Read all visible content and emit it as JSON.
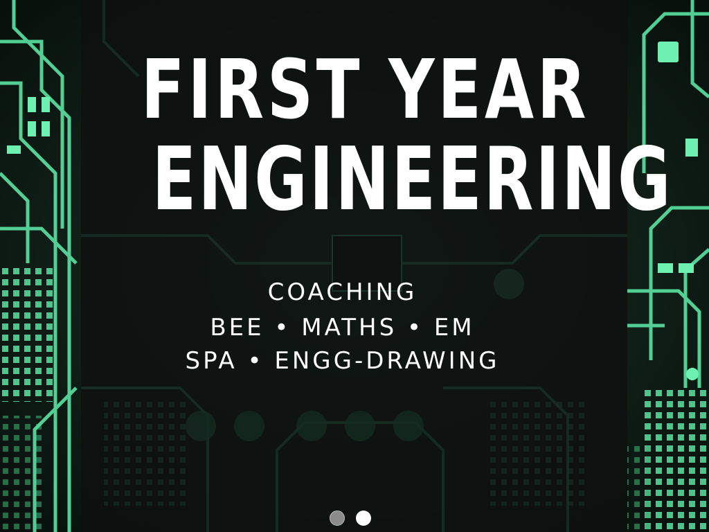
{
  "banner": {
    "title_line_1": "FIRST YEAR",
    "title_line_2": "ENGINEERING",
    "subtitle_1": "COACHING",
    "subtitle_2": "BEE • MATHS • EM",
    "subtitle_3": "SPA • ENGG-DRAWING"
  },
  "slider": {
    "slide_count": 2,
    "active_index": 1
  },
  "colors": {
    "circuit_green": "#4fd49a",
    "panel_dark": "#0e100f",
    "text": "#ffffff"
  }
}
